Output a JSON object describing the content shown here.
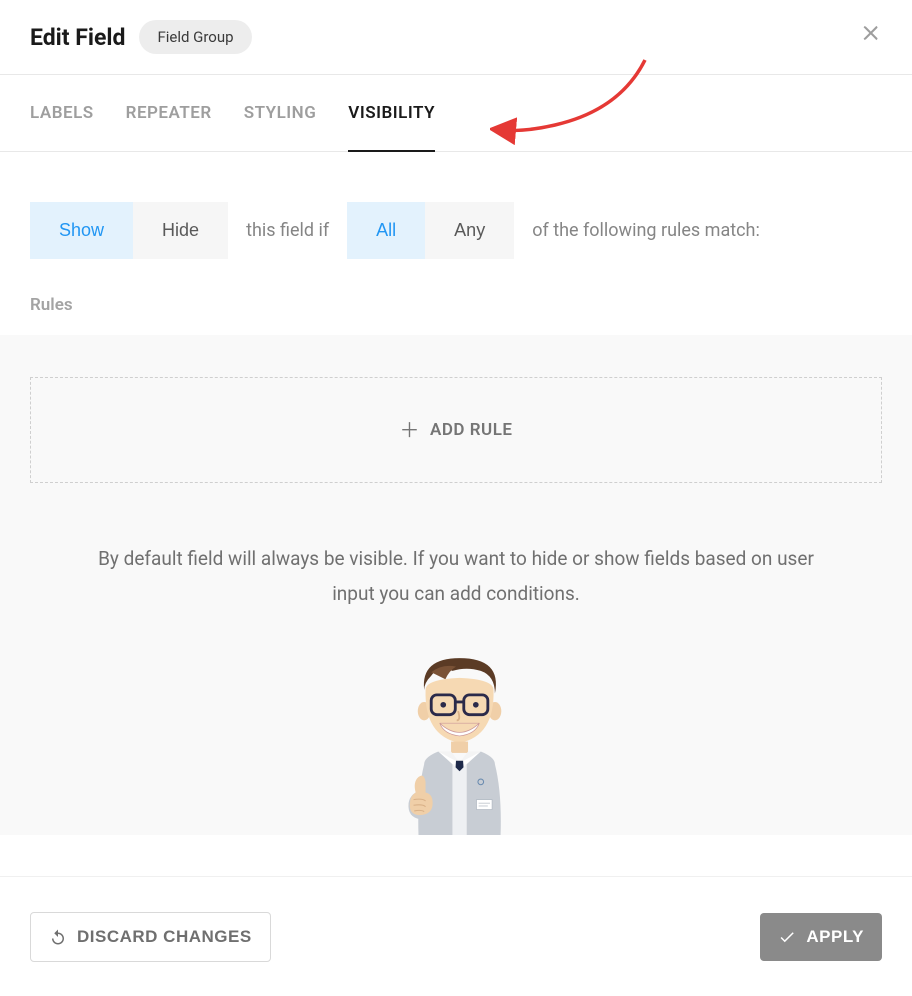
{
  "header": {
    "title": "Edit Field",
    "badge": "Field Group"
  },
  "tabs": [
    {
      "label": "LABELS",
      "active": false
    },
    {
      "label": "REPEATER",
      "active": false
    },
    {
      "label": "STYLING",
      "active": false
    },
    {
      "label": "VISIBILITY",
      "active": true
    }
  ],
  "condition": {
    "showhide": {
      "options": [
        "Show",
        "Hide"
      ],
      "selected": "Show"
    },
    "text1": "this field if",
    "allany": {
      "options": [
        "All",
        "Any"
      ],
      "selected": "All"
    },
    "text2": "of the following rules match:"
  },
  "rules": {
    "section_label": "Rules",
    "add_label": "ADD RULE"
  },
  "help": "By default field will always be visible. If you want to hide or show fields based on user input you can add conditions.",
  "footer": {
    "discard": "DISCARD CHANGES",
    "apply": "APPLY"
  }
}
